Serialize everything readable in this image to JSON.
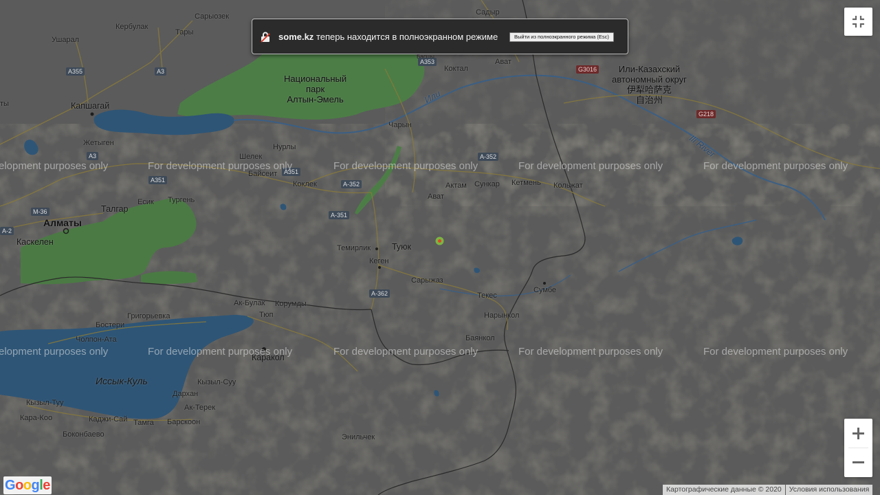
{
  "fullscreen_notice": {
    "site": "some.kz",
    "message": "теперь находится в полноэкранном режиме",
    "exit_button": "Выйти из полноэкранного режима (Esc)"
  },
  "controls": {
    "exit_fullscreen_icon": "exit-fullscreen-icon",
    "zoom_in": "+",
    "zoom_out": "−"
  },
  "watermark_text": "For development purposes only",
  "attribution": {
    "map_data": "Картографические данные © 2020",
    "terms": "Условия использования"
  },
  "logo": "Google",
  "labels": {
    "saryozek": "Сарыозек",
    "sadyr": "Садыр",
    "kerbulak": "Кербулак",
    "tary": "Тары",
    "basshi": "Басшы",
    "usharal": "Ушарал",
    "koktal": "Коктал",
    "avat1": "Ават",
    "park": [
      "Национальный",
      "парк",
      "Алтын-Эмель"
    ],
    "ili_river": "Или",
    "ili_region": [
      "Или-Казахский",
      "автономный округ",
      "伊犁哈萨克",
      "自治州"
    ],
    "kapshagai": "Капшагай",
    "ty": "ты",
    "charyn": "Чарын",
    "zhetygen": "Жетыген",
    "nurly": "Нурлы",
    "shelek": "Шелек",
    "baiseit": "Байсеит",
    "koklek": "Коклек",
    "aktam": "Актам",
    "sunkar": "Сункар",
    "ketmen": "Кетмень",
    "kolzhat": "Кольжат",
    "avat2": "Ават",
    "ili_river_en": "Ili River",
    "talgar": "Талгар",
    "esik": "Есик",
    "turgen": "Тургень",
    "almaty": "Алматы",
    "kaskelen": "Каскелен",
    "temirlik": "Темирлик",
    "tuyuk": "Туюк",
    "kegen": "Кеген",
    "saryzhaz": "Сарыжаз",
    "sumbe": "Сумбе",
    "tekes": "Текес",
    "akbulak": "Ак-Булак",
    "korumdy": "Корумды",
    "grigorievka": "Григорьевка",
    "tyup": "Тюп",
    "narynkol": "Нарынкол",
    "bosteri": "Бостери",
    "cholpon_ata": "Чолпон-Ата",
    "bayankol": "Баянкол",
    "karakol": "Каракол",
    "issyk_kul": "Иссык-Куль",
    "kyzyl_suu": "Кызыл-Суу",
    "darkhan": "Дархан",
    "kyzyl_tuu": "Кызыл-Туу",
    "ak_terek": "Ак-Терек",
    "kara_koo": "Кара-Коо",
    "kadzhi_sai": "Каджи-Сай",
    "tamga": "Тамга",
    "barskoon": "Барскоон",
    "bokonbaevo": "Боконбаево",
    "enilchek": "Энильчек"
  },
  "roads": {
    "a355": "A355",
    "a3": "A3",
    "a3b": "A3",
    "a353": "A353",
    "g3016": "G3016",
    "g218": "G218",
    "a352a": "A-352",
    "a351a": "A351",
    "a351b": "A351",
    "a352b": "A-352",
    "m36": "M-36",
    "a351c": "A-351",
    "a2": "A-2",
    "a362": "A-362"
  }
}
